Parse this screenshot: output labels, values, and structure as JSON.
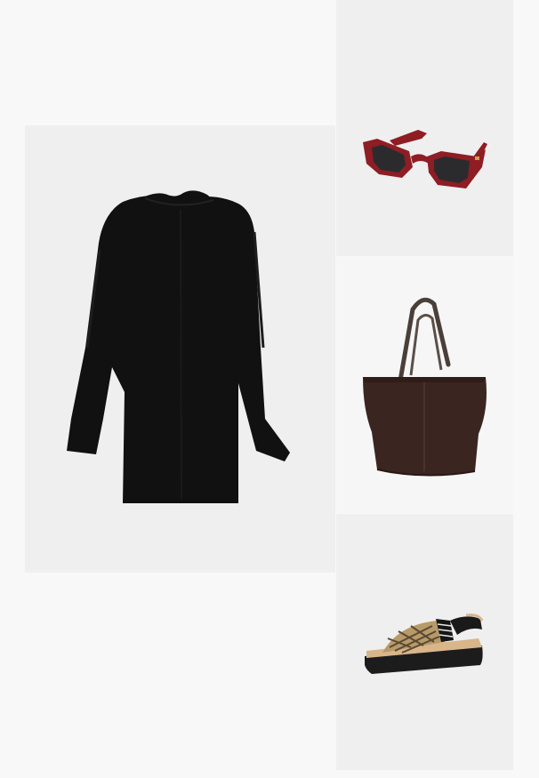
{
  "outfit": {
    "items": [
      {
        "name": "dress",
        "icon": "black-dress-icon",
        "color": "#111111"
      },
      {
        "name": "sunglasses",
        "icon": "sunglasses-icon",
        "color": "#8f1d24"
      },
      {
        "name": "bag",
        "icon": "tote-bag-icon",
        "color": "#3a2520"
      },
      {
        "name": "sandal",
        "icon": "sandal-icon",
        "color": "#1c1c1c"
      }
    ]
  },
  "colors": {
    "page_background": "#f8f8f8",
    "tile_background": "#efefef",
    "bag_tile_background": "#f6f6f6"
  }
}
